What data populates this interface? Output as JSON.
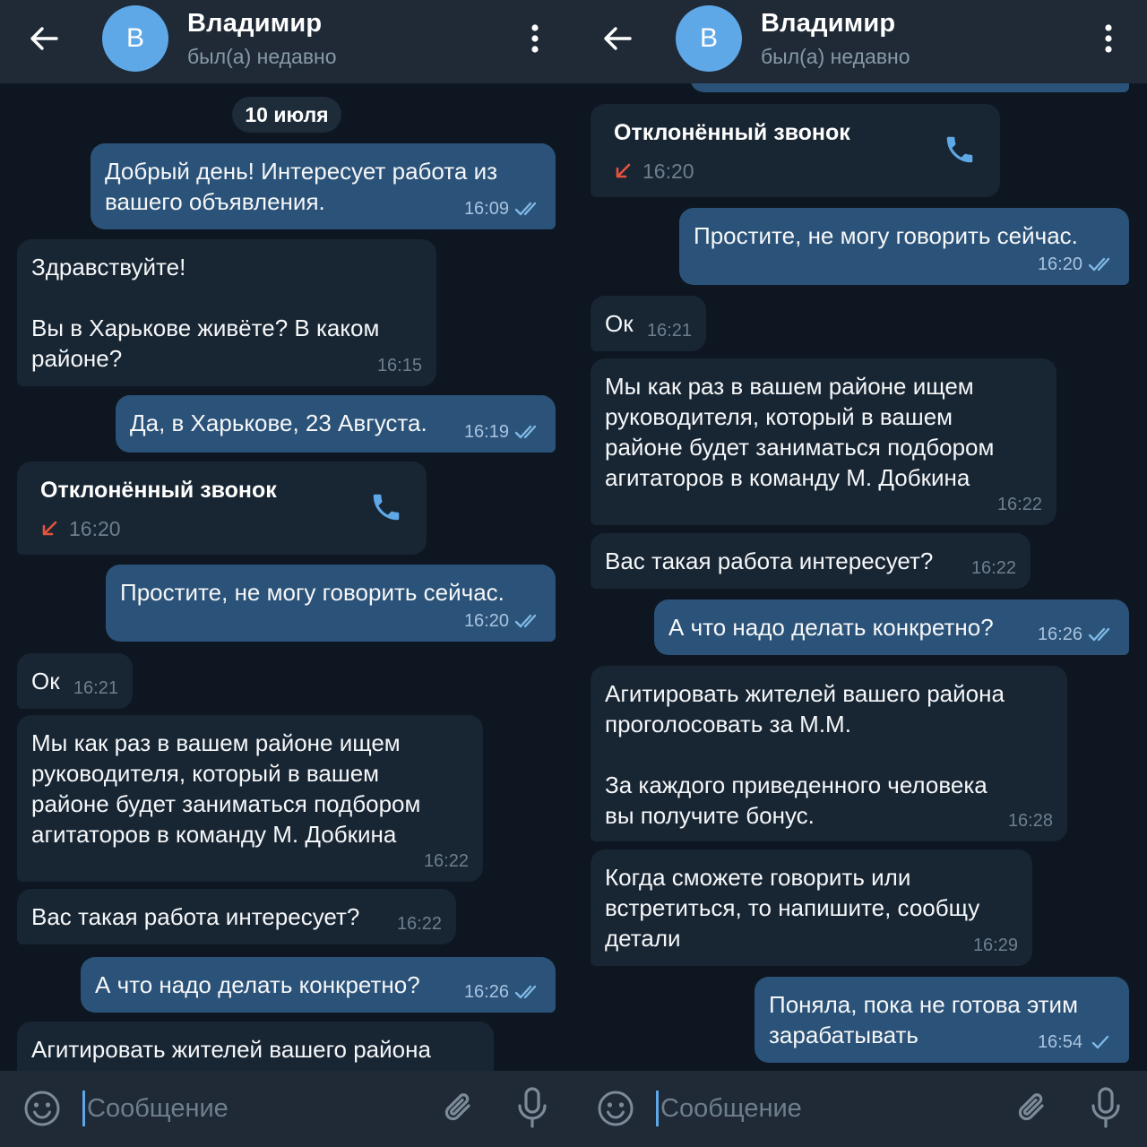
{
  "chat": {
    "name": "Владимир",
    "status": "был(а) недавно",
    "avatar_letter": "В",
    "date_label": "10 июля",
    "input_placeholder": "Сообщение"
  },
  "colors": {
    "background": "#0e1621",
    "header": "#1f2a36",
    "incoming_bubble": "#182533",
    "outgoing_bubble": "#2b5278",
    "avatar": "#5fa8e8",
    "missed_call_arrow": "#e5533d",
    "read_check": "#7fb8e6"
  },
  "icons": [
    "back-arrow-icon",
    "more-vert-icon",
    "double-check-icon",
    "single-check-icon",
    "phone-icon",
    "missed-call-arrow-icon",
    "emoji-icon",
    "paperclip-icon",
    "microphone-icon"
  ],
  "left": {
    "messages": [
      {
        "text": "Добрый день! Интересует работа из\nвашего объявления.",
        "time": "16:09"
      },
      {
        "text": "Здравствуйте!\n\nВы в Харькове живёте? В каком\nрайоне?",
        "time": "16:15"
      },
      {
        "text": "Да, в Харькове, 23 Августа.",
        "time": "16:19"
      },
      {
        "title": "Отклонённый звонок",
        "time": "16:20"
      },
      {
        "text": "Простите, не могу говорить сейчас.",
        "time": "16:20"
      },
      {
        "text": "Ок",
        "time": "16:21"
      },
      {
        "text": "Мы как раз в вашем районе ищем\nруководителя, который в вашем\nрайоне будет заниматься подбором\nагитаторов в команду М. Добкина",
        "time": "16:22"
      },
      {
        "text": "Вас такая работа интересует?",
        "time": "16:22"
      },
      {
        "text": "А что надо делать конкретно?",
        "time": "16:26"
      },
      {
        "text": "Агитировать жителей вашего района"
      }
    ]
  },
  "right": {
    "messages": [
      {
        "title": "Отклонённый звонок",
        "time": "16:20"
      },
      {
        "text": "Простите, не могу говорить сейчас.",
        "time": "16:20"
      },
      {
        "text": "Ок",
        "time": "16:21"
      },
      {
        "text": "Мы как раз в вашем районе ищем\nруководителя, который в вашем\nрайоне будет заниматься подбором\nагитаторов в команду М. Добкина",
        "time": "16:22"
      },
      {
        "text": "Вас такая работа интересует?",
        "time": "16:22"
      },
      {
        "text": "А что надо делать конкретно?",
        "time": "16:26"
      },
      {
        "text": "Агитировать жителей вашего района\nпроголосовать за М.М.\n\nЗа каждого приведенного человека\nвы получите бонус.",
        "time": "16:28"
      },
      {
        "text": "Когда сможете говорить или\nвстретиться, то напишите, сообщу\nдетали",
        "time": "16:29"
      },
      {
        "text": "Поняла, пока не готова этим\nзарабатывать",
        "time": "16:54"
      }
    ]
  }
}
